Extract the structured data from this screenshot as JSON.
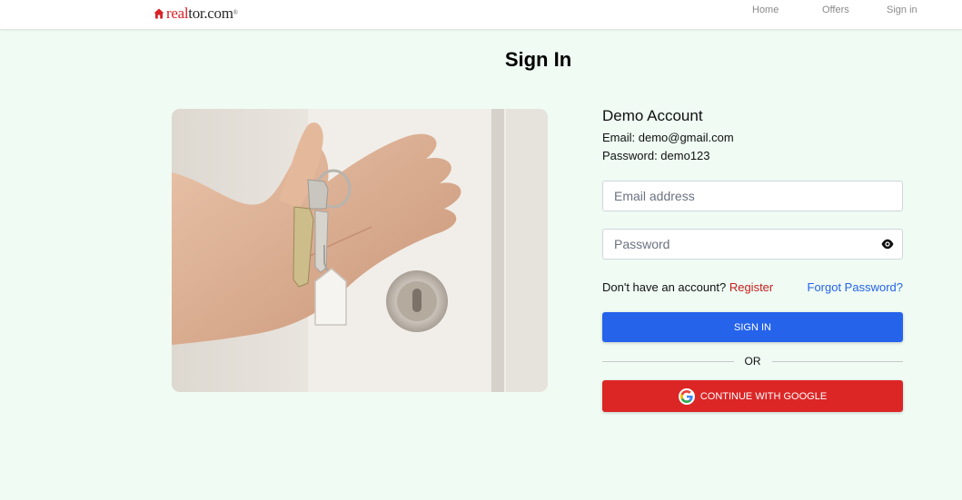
{
  "header": {
    "logo": {
      "part1": "real",
      "part2": "tor.com",
      "icon": "house-icon"
    },
    "nav": [
      {
        "label": "Home"
      },
      {
        "label": "Offers"
      },
      {
        "label": "Sign in"
      }
    ]
  },
  "page": {
    "title": "Sign In"
  },
  "hero": {
    "image": "hand-holding-house-keys-photo"
  },
  "demo": {
    "title": "Demo Account",
    "email_line": "Email: demo@gmail.com",
    "password_line": "Password: demo123"
  },
  "form": {
    "email": {
      "value": "",
      "placeholder": "Email address"
    },
    "password": {
      "value": "",
      "placeholder": "Password",
      "toggle_icon": "eye-icon"
    },
    "no_account_text": "Don't have an account?",
    "register_label": "Register",
    "forgot_label": "Forgot Password?",
    "signin_label": "SIGN IN",
    "or_label": "OR",
    "google_label": "CONTINUE WITH GOOGLE",
    "google_icon": "google-icon"
  },
  "colors": {
    "background": "#effbf3",
    "brand_red": "#d92228",
    "primary_blue": "#2563eb",
    "google_red": "#dc2626",
    "link_blue": "#2563eb",
    "register_red": "#c81e1e"
  }
}
